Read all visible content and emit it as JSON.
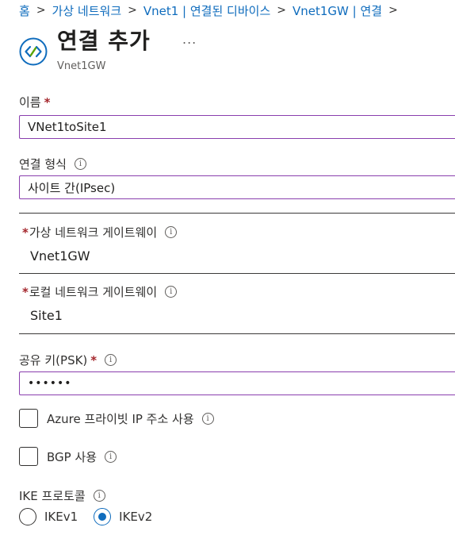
{
  "breadcrumb": {
    "items": [
      "홈",
      "가상 네트워크",
      "Vnet1 | 연결된 디바이스",
      "Vnet1GW | 연결"
    ],
    "separator": ">"
  },
  "header": {
    "title": "연결 추가",
    "subtitle": "Vnet1GW",
    "more_label": "...",
    "icon": "connection-icon"
  },
  "form": {
    "name": {
      "label": "이름",
      "required_mark": "*",
      "value": "VNet1toSite1"
    },
    "connection_type": {
      "label": "연결 형식",
      "info": "i",
      "value": "사이트 간(IPsec)"
    },
    "virtual_network_gateway": {
      "required_mark": "*",
      "label": "가상 네트워크 게이트웨이",
      "info": "i",
      "value": "Vnet1GW"
    },
    "local_network_gateway": {
      "required_mark": "*",
      "label": "로컬 네트워크 게이트웨이",
      "info": "i",
      "value": "Site1"
    },
    "shared_key": {
      "label": "공유 키(PSK)",
      "required_mark": "*",
      "info": "i",
      "value": "••••••"
    },
    "azure_private_ip": {
      "label": "Azure 프라이빗 IP 주소 사용",
      "info": "i",
      "checked": false
    },
    "bgp": {
      "label": "BGP 사용",
      "info": "i",
      "checked": false
    },
    "ike_protocol": {
      "label": "IKE 프로토콜",
      "info": "i",
      "options": [
        "IKEv1",
        "IKEv2"
      ],
      "selected": "IKEv2"
    }
  },
  "colors": {
    "link": "#0f6cbd",
    "required": "#a4262c",
    "focus_border": "#8a3fae",
    "text": "#323130"
  }
}
